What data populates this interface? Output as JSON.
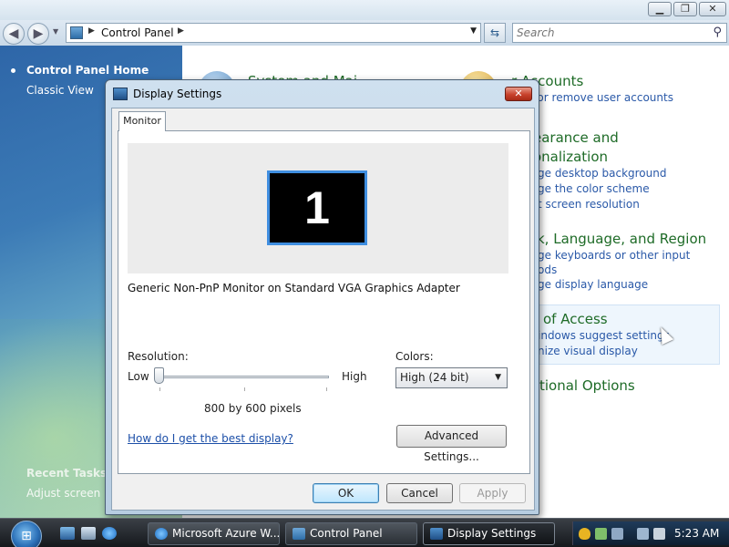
{
  "explorer": {
    "address": "Control Panel",
    "search_placeholder": "Search"
  },
  "sidebar": {
    "home": "Control Panel Home",
    "classic": "Classic View",
    "recent_tasks_title": "Recent Tasks",
    "recent_task": "Adjust screen re"
  },
  "categories": {
    "system_title": "System and Mai",
    "user_title": "r Accounts",
    "user_link": "d or remove user accounts",
    "appearance_title_1": "earance and",
    "appearance_title_2": "onalization",
    "appearance_link_1": "ge desktop background",
    "appearance_link_2": "ge the color scheme",
    "appearance_link_3": "t screen resolution",
    "clock_title": "k, Language, and Region",
    "clock_link_1": "ge keyboards or other input",
    "clock_link_2": "ods",
    "clock_link_3": "ge display language",
    "ease_title": "of Access",
    "ease_link_1": "indows suggest settings",
    "ease_link_2": "nize visual display",
    "additional_title": "tional Options"
  },
  "dialog": {
    "title": "Display Settings",
    "close_glyph": "✕",
    "tab_monitor": "Monitor",
    "monitor_number": "1",
    "monitor_name": "Generic Non-PnP Monitor on Standard VGA Graphics Adapter",
    "resolution_label": "Resolution:",
    "low_label": "Low",
    "high_label": "High",
    "resolution_value": "800 by 600 pixels",
    "resolution_slider_position": 0,
    "colors_label": "Colors:",
    "colors_value": "High (24 bit)",
    "help_link": "How do I get the best display?",
    "advanced_button": "Advanced Settings...",
    "ok_button": "OK",
    "cancel_button": "Cancel",
    "apply_button": "Apply"
  },
  "taskbar": {
    "tasks": [
      "Microsoft Azure W...",
      "Control Panel",
      "Display Settings"
    ],
    "clock": "5:23 AM"
  },
  "colors": {
    "category_title": "#1e6b27",
    "link": "#2a59a8",
    "monitor_highlight": "#3f8ee0"
  }
}
